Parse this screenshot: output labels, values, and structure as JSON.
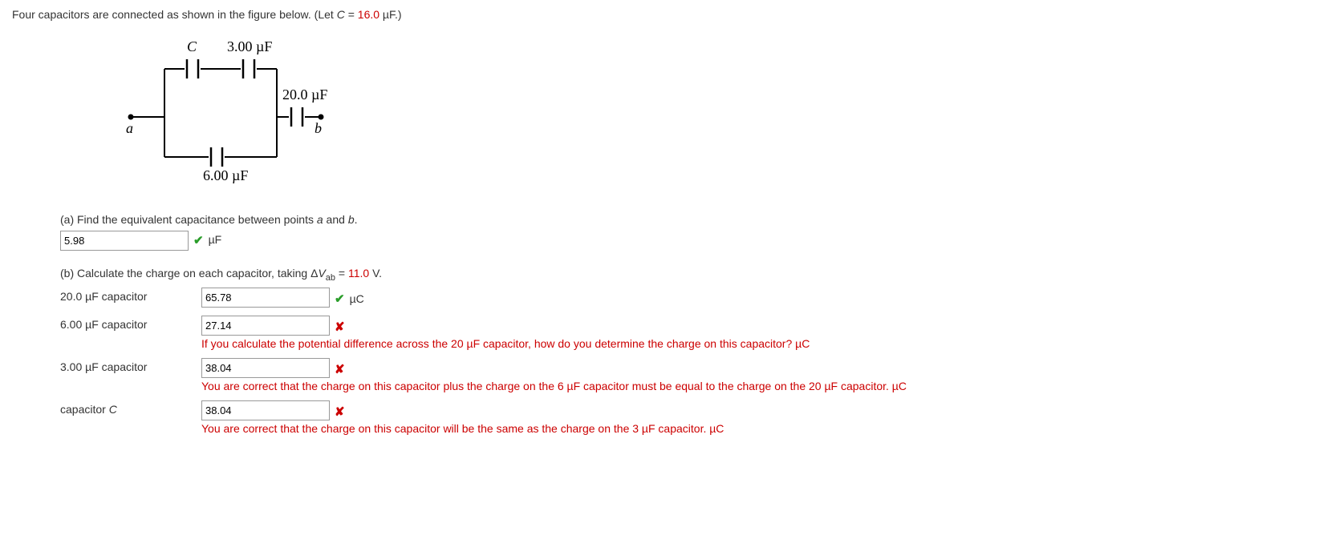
{
  "problem": {
    "intro_before": "Four capacitors are connected as shown in the figure below. (Let ",
    "intro_var": "C",
    "intro_mid": " = ",
    "intro_value": "16.0",
    "intro_after": " µF.)"
  },
  "figure": {
    "label_C": "C",
    "label_3": "3.00 µF",
    "label_20": "20.0 µF",
    "label_6": "6.00 µF",
    "label_a": "a",
    "label_b": "b"
  },
  "partA": {
    "prompt_before": "(a) Find the equivalent capacitance between points ",
    "prompt_a": "a",
    "prompt_and": " and ",
    "prompt_b": "b",
    "prompt_after": ".",
    "answer_value": "5.98",
    "unit": "µF"
  },
  "partB": {
    "prompt_before": "(b) Calculate the charge on each capacitor, taking Δ",
    "prompt_var": "V",
    "prompt_sub": "ab",
    "prompt_mid": " = ",
    "prompt_value": "11.0",
    "prompt_after": " V.",
    "rows": {
      "r20": {
        "label": "20.0 µF capacitor",
        "value": "65.78",
        "unit": "µC",
        "correct": true
      },
      "r6": {
        "label": "6.00 µF capacitor",
        "value": "27.14",
        "unit": "µC",
        "correct": false,
        "feedback": "If you calculate the potential difference across the 20 µF capacitor, how do you determine the charge on this capacitor? µC"
      },
      "r3": {
        "label": "3.00 µF capacitor",
        "value": "38.04",
        "unit": "µC",
        "correct": false,
        "feedback": "You are correct that the charge on this capacitor plus the charge on the 6 µF capacitor must be equal to the charge on the 20 µF capacitor. µC"
      },
      "rC": {
        "label_before": "capacitor ",
        "label_var": "C",
        "value": "38.04",
        "unit": "µC",
        "correct": false,
        "feedback": "You are correct that the charge on this capacitor will be the same as the charge on the 3 µF capacitor. µC"
      }
    }
  }
}
